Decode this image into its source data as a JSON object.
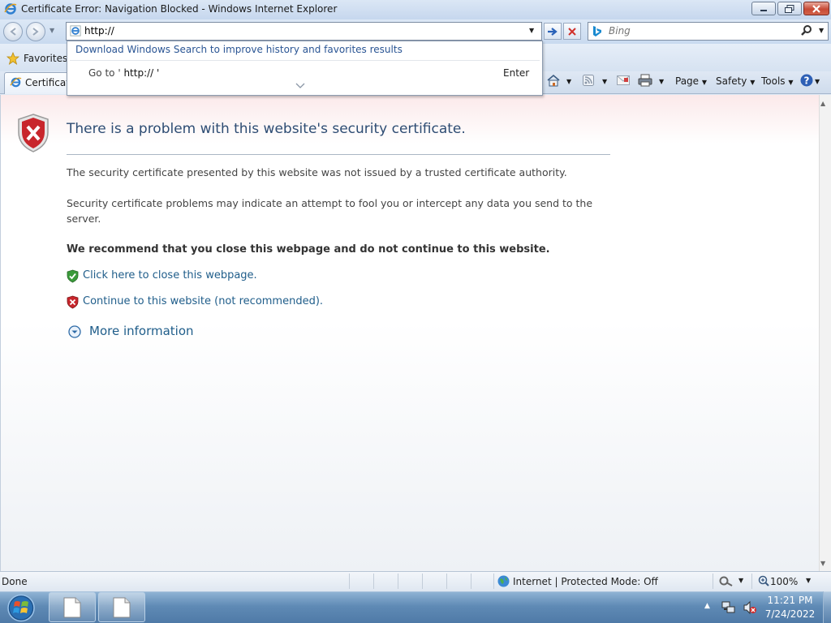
{
  "window": {
    "title": "Certificate Error: Navigation Blocked - Windows Internet Explorer"
  },
  "navbar": {
    "address_value": "http://",
    "search_placeholder": "Bing"
  },
  "autocomplete": {
    "search_suggestion": "Download Windows Search to improve history and favorites results",
    "goto_prefix": "Go to '",
    "goto_url": " http:// '",
    "enter_label": "Enter"
  },
  "favorites": {
    "label": "Favorites"
  },
  "tab": {
    "label": "Certificate Error"
  },
  "commandbar": {
    "page_label": "Page",
    "safety_label": "Safety",
    "tools_label": "Tools"
  },
  "content": {
    "title": "There is a problem with this website's security certificate.",
    "para1": "The security certificate presented by this website was not issued by a trusted certificate authority.",
    "para2": "Security certificate problems may indicate an attempt to fool you or intercept any data you send to the server.",
    "recommend": "We recommend that you close this webpage and do not continue to this website.",
    "close_link": "Click here to close this webpage.",
    "continue_link": "Continue to this website (not recommended).",
    "more_info": "More information"
  },
  "statusbar": {
    "status": "Done",
    "zone": "Internet | Protected Mode: Off",
    "zoom": "100%"
  },
  "taskbar": {
    "time": "11:21 PM",
    "date": "7/24/2022"
  },
  "colors": {
    "link": "#1f5d8a",
    "title_text": "#2d4c73",
    "shield_red": "#c8262c",
    "shield_green": "#3a9a3a",
    "taskbar": "#5f8ab5"
  }
}
